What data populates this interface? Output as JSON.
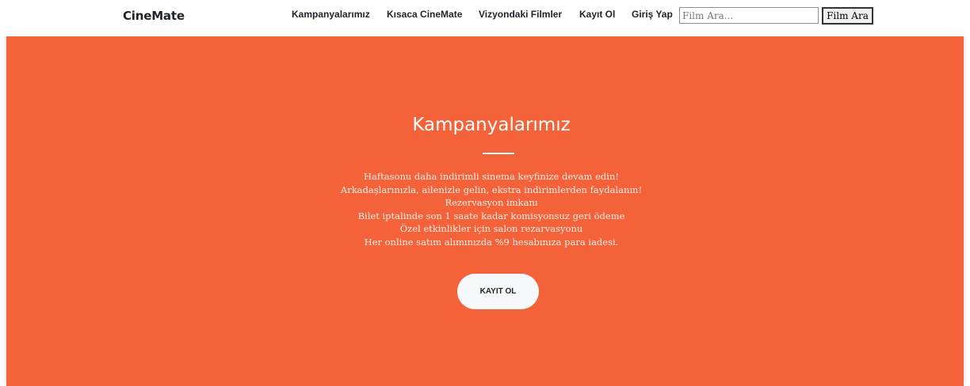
{
  "navbar": {
    "brand": "CineMate",
    "links": [
      {
        "label": "Kampanyalarımız"
      },
      {
        "label": "Kısaca CineMate"
      },
      {
        "label": "Vizyondaki Filmler"
      },
      {
        "label": "Kayıt Ol"
      },
      {
        "label": "Giriş Yap"
      }
    ],
    "search": {
      "placeholder": "Film Ara...",
      "value": "",
      "button_label": "Film Ara"
    }
  },
  "hero": {
    "title": "Kampanyalarımız",
    "lines": [
      "Haftasonu daha indirimli sinema keyfinize devam edin!",
      "Arkadaşlarınızla, ailenizle gelin, ekstra indirimlerden faydalanın!",
      "Rezervasyon imkanı",
      "Bilet iptalinde son 1 saate kadar komisyonsuz geri ödeme",
      "Özel etkinlikler için salon rezarvasyonu",
      "Her online satım alımınızda %9 hesabınıza para iadesi."
    ],
    "cta_label": "KAYIT OL"
  },
  "colors": {
    "hero_background": "#f4623a",
    "text_dark": "#212529",
    "cta_background": "#f8f9fa"
  }
}
